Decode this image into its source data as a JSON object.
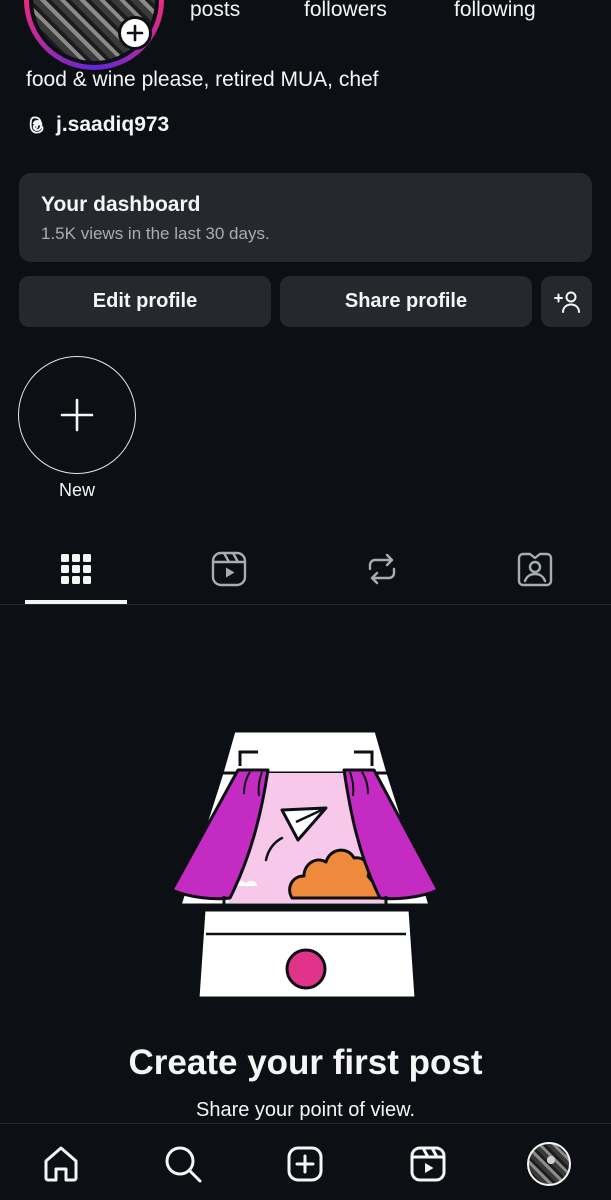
{
  "profile": {
    "stats": {
      "posts_label": "posts",
      "followers_label": "followers",
      "following_label": "following"
    },
    "bio": "food & wine please, retired MUA, chef",
    "threads_handle": "j.saadiq973"
  },
  "dashboard": {
    "title": "Your dashboard",
    "subtitle": "1.5K views in the last 30 days."
  },
  "actions": {
    "edit_label": "Edit profile",
    "share_label": "Share profile"
  },
  "highlights": {
    "new_label": "New"
  },
  "tabs": [
    {
      "icon": "grid-icon",
      "active": true
    },
    {
      "icon": "reels-icon",
      "active": false
    },
    {
      "icon": "reposts-icon",
      "active": false
    },
    {
      "icon": "tagged-icon",
      "active": false
    }
  ],
  "empty_state": {
    "title": "Create your first post",
    "subtitle": "Share your point of view."
  },
  "bottom_nav": [
    {
      "icon": "home-icon"
    },
    {
      "icon": "search-icon"
    },
    {
      "icon": "create-icon"
    },
    {
      "icon": "reels-icon"
    },
    {
      "icon": "profile-avatar"
    }
  ],
  "colors": {
    "background": "#0c1014",
    "surface": "#25292e",
    "text": "#f5f5f5",
    "muted": "#a8adb3",
    "curtain": "#c42bc2",
    "cloud": "#ef8a3c",
    "lens": "#e0348a"
  }
}
